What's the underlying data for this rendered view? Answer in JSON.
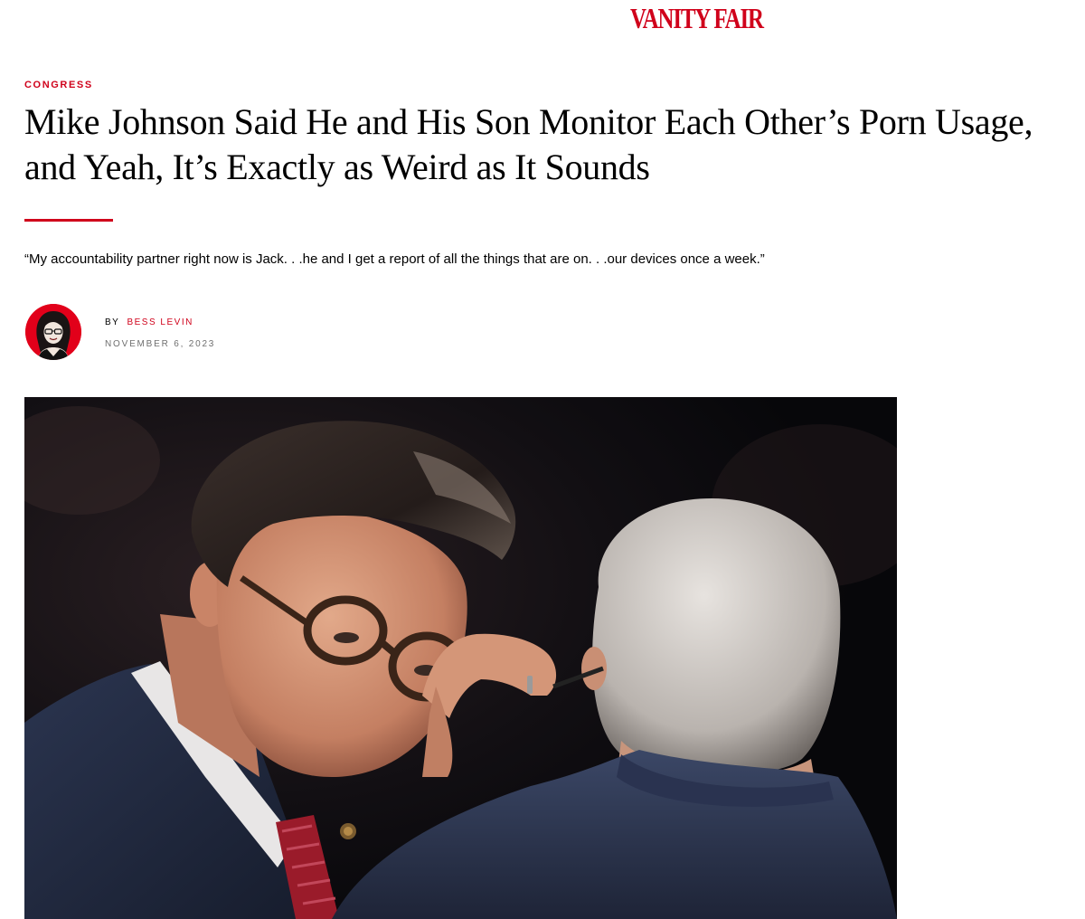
{
  "site": {
    "logo_text": "VANITY FAIR",
    "brand_color": "#d0021b"
  },
  "article": {
    "rubric": "CONGRESS",
    "headline": "Mike Johnson Said He and His Son Monitor Each Other’s Porn Usage, and Yeah, It’s Exactly as Weird as It Sounds",
    "dek": "“My accountability partner right now is Jack. . .he and I get a report of all the things that are on. . .our devices once a week.”",
    "byline_prefix": "BY",
    "author": "BESS LEVIN",
    "date": "NOVEMBER 6, 2023"
  },
  "icons": {
    "avatar": "author-portrait-illustration",
    "hero": "hero-photo"
  }
}
